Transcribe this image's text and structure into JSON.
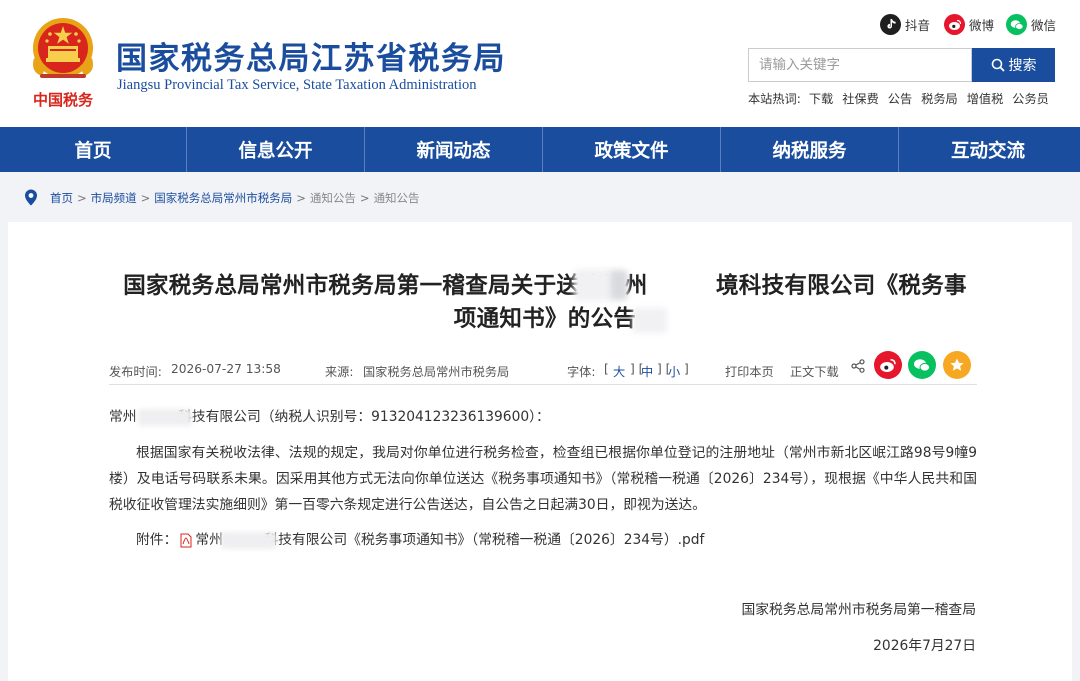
{
  "header": {
    "title": "国家税务总局江苏省税务局",
    "subtitle": "Jiangsu Provincial Tax Service, State Taxation Administration",
    "emblem_text": "中国税务",
    "social": [
      {
        "label": "抖音",
        "icon": "douyin-icon",
        "color": "#1f1f1f"
      },
      {
        "label": "微博",
        "icon": "weibo-icon",
        "color": "#e6162d"
      },
      {
        "label": "微信",
        "icon": "wechat-icon",
        "color": "#07c160"
      }
    ],
    "search": {
      "placeholder": "请输入关键字",
      "button_label": "搜索"
    },
    "hotwords": {
      "label": "本站热词:",
      "items": [
        "下载",
        "社保费",
        "公告",
        "税务局",
        "增值税",
        "公务员"
      ]
    }
  },
  "nav": {
    "items": [
      "首页",
      "信息公开",
      "新闻动态",
      "政策文件",
      "纳税服务",
      "互动交流"
    ]
  },
  "breadcrumb": {
    "items": [
      "首页",
      "市局频道",
      "国家税务总局常州市税务局",
      "通知公告",
      "通知公告"
    ],
    "separator": ">"
  },
  "article": {
    "title": "国家税务总局常州市税务局第一稽查局关于送达常州　　　境科技有限公司《税务事项通知书》的公告",
    "meta": {
      "publish_label": "发布时间:",
      "publish_time": "2026-07-27 13:58",
      "source_label": "来源:",
      "source": "国家税务总局常州市税务局",
      "font_size_label": "字体:",
      "font_large": "大",
      "font_medium": "中",
      "font_small": "小",
      "print_label": "打印本页",
      "download_label": "正文下载"
    },
    "share": [
      {
        "icon": "weibo-share-icon",
        "color": "#e6162d"
      },
      {
        "icon": "wechat-share-icon",
        "color": "#07c160"
      },
      {
        "icon": "favorite-share-icon",
        "color": "#f7a823"
      }
    ],
    "addressee": "常州　　　科技有限公司（纳税人识别号：913204123236139600）：",
    "paragraph": "根据国家有关税收法律、法规的规定，我局对你单位进行税务检查，检查组已根据你单位登记的注册地址（常州市新北区岷江路98号9幢9楼）及电话号码联系未果。因采用其他方式无法向你单位送达《税务事项通知书》（常税稽一税通〔2026〕234号），现根据《中华人民共和国税收征收管理法实施细则》第一百零六条规定进行公告送达，自公告之日起满30日，即视为送达。",
    "attachment_label": "附件：",
    "attachment_name": "常州　　　科技有限公司《税务事项通知书》（常税稽一税通〔2026〕234号）.pdf",
    "signature": "国家税务总局常州市税务局第一稽查局",
    "sign_date": "2026年7月27日"
  },
  "colors": {
    "brand_blue": "#1a4d9e",
    "page_bg": "#f1f3f6"
  }
}
